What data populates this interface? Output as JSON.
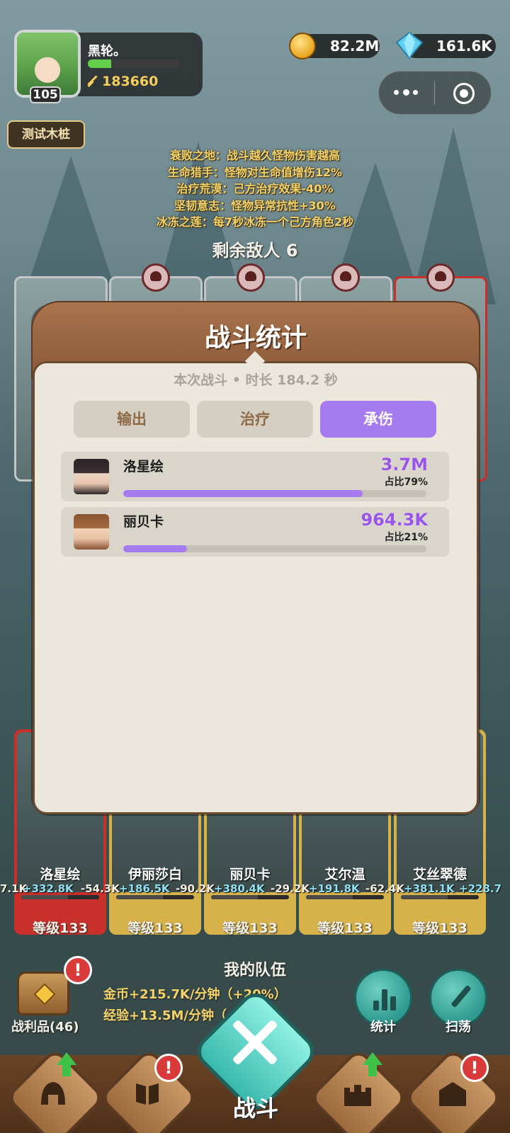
{
  "player": {
    "name": "黑轮。",
    "level": "105",
    "power": "183660",
    "xp_fraction": 0.25
  },
  "currencies": {
    "gold": "82.2M",
    "gems": "161.6K"
  },
  "mode": "测试木桩",
  "modifiers": [
    "衰败之地：战斗越久怪物伤害越高",
    "生命猎手：怪物对生命值增伤12%",
    "治疗荒漠：己方治疗效果-40%",
    "坚韧意志：怪物异常抗性+30%",
    "冰冻之莲：每7秒冰冻一个己方角色2秒"
  ],
  "enemies_left": "剩余敌人 6",
  "stats_modal": {
    "title": "战斗统计",
    "battle_info": "本次战斗 • 时长 184.2 秒",
    "tabs": [
      "输出",
      "治疗",
      "承伤"
    ],
    "active_tab": 2,
    "rows": [
      {
        "name": "洛星绘",
        "value": "3.7M",
        "share": "占比79%",
        "fraction": 0.79
      },
      {
        "name": "丽贝卡",
        "value": "964.3K",
        "share": "占比21%",
        "fraction": 0.21
      }
    ]
  },
  "heroes": [
    {
      "name": "洛星绘",
      "level": "等级133",
      "border": "#c9302c"
    },
    {
      "name": "伊丽莎白",
      "level": "等级133",
      "border": "#d7b24a"
    },
    {
      "name": "丽贝卡",
      "level": "等级133",
      "border": "#d7b24a"
    },
    {
      "name": "艾尔温",
      "level": "等级133",
      "border": "#d7b24a"
    },
    {
      "name": "艾丝翠德",
      "level": "等级133",
      "border": "#d7b24a"
    }
  ],
  "hero_stats": [
    {
      "text": "7.1K",
      "kind": "red"
    },
    {
      "text": "+332.8K",
      "kind": "green"
    },
    {
      "text": "-54.3K",
      "kind": "red"
    },
    {
      "text": "+186.5K",
      "kind": "green"
    },
    {
      "text": "-90.2K",
      "kind": "red"
    },
    {
      "text": "+380.4K",
      "kind": "green"
    },
    {
      "text": "-29.2K",
      "kind": "red"
    },
    {
      "text": "+191.8K",
      "kind": "green"
    },
    {
      "text": "-62.4K",
      "kind": "red"
    },
    {
      "text": "+381.1K",
      "kind": "green"
    },
    {
      "text": "+228.7",
      "kind": "green"
    }
  ],
  "team": {
    "title": "我的队伍",
    "loot_label": "战利品(46)",
    "gold_rate": "金币+215.7K/分钟（+20%）",
    "exp_rate": "经验+13.5M/分钟（+20%）",
    "stats_label": "统计",
    "sweep_label": "扫荡"
  },
  "nav": {
    "battle_label": "战斗"
  },
  "colors": {
    "accent_purple": "#a77bf0",
    "modifier_gold": "#f3d36a",
    "modal_brown": "#8b5a39",
    "alert_red": "#d93b3b"
  }
}
